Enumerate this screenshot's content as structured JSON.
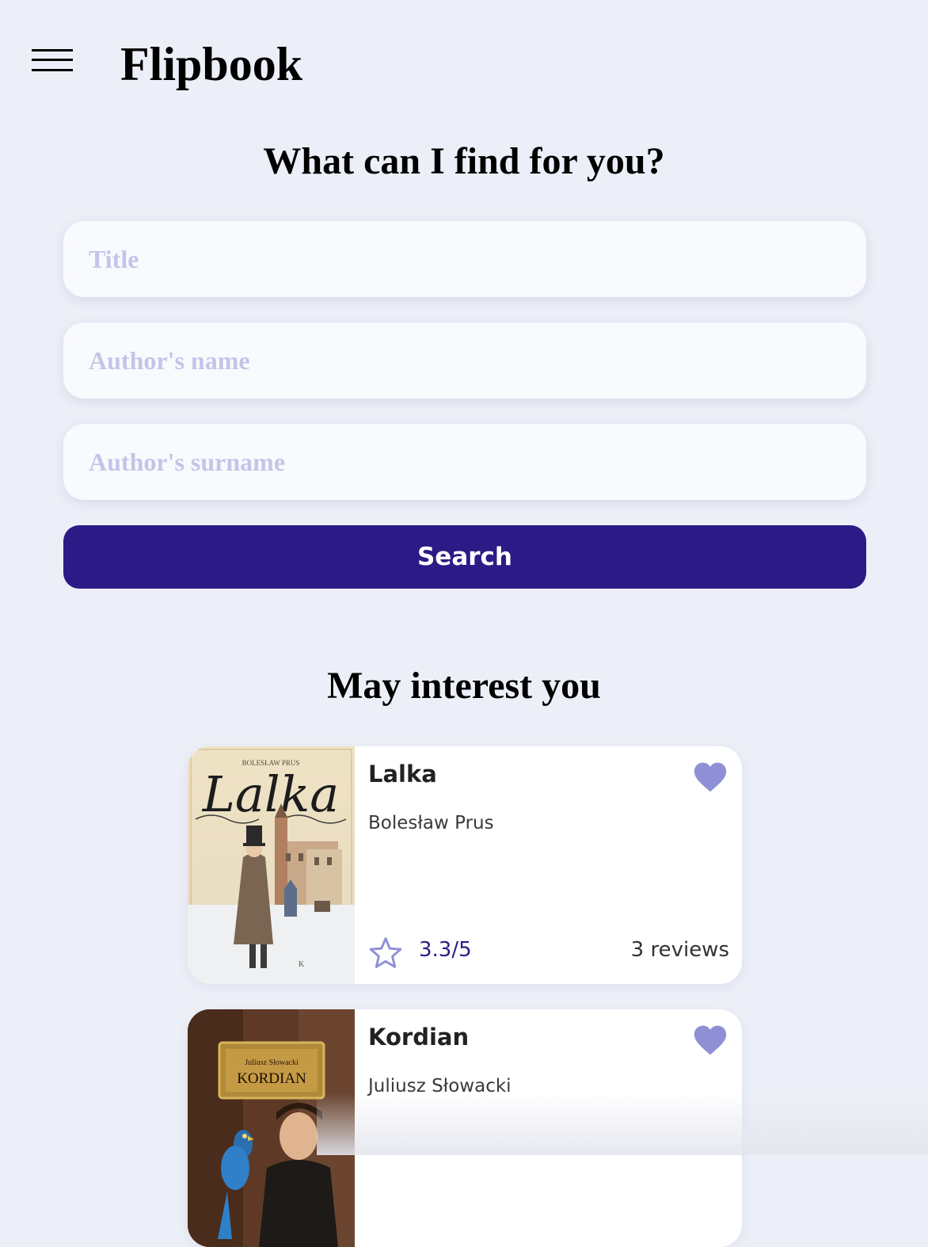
{
  "header": {
    "menu_icon": "hamburger-icon",
    "brand": "Flipbook"
  },
  "search": {
    "heading": "What can I find for you?",
    "title_placeholder": "Title",
    "name_placeholder": "Author's name",
    "surname_placeholder": "Author's surname",
    "button_label": "Search"
  },
  "recommendations": {
    "heading": "May interest you",
    "books": [
      {
        "title": "Lalka",
        "author": "Bolesław Prus",
        "rating": "3.3/5",
        "reviews": "3 reviews",
        "cover_author": "BOLESŁAW PRUS",
        "cover_title": "Lalka",
        "favorite_icon": "heart-icon"
      },
      {
        "title": "Kordian",
        "author": "Juliusz Słowacki",
        "cover_author": "Juliusz Słowacki",
        "cover_title": "KORDIAN",
        "favorite_icon": "heart-icon"
      }
    ]
  },
  "colors": {
    "background": "#eceff7",
    "accent": "#2c1b86",
    "icon_lavender": "#8f8fd6",
    "placeholder": "#c3c5e8"
  }
}
